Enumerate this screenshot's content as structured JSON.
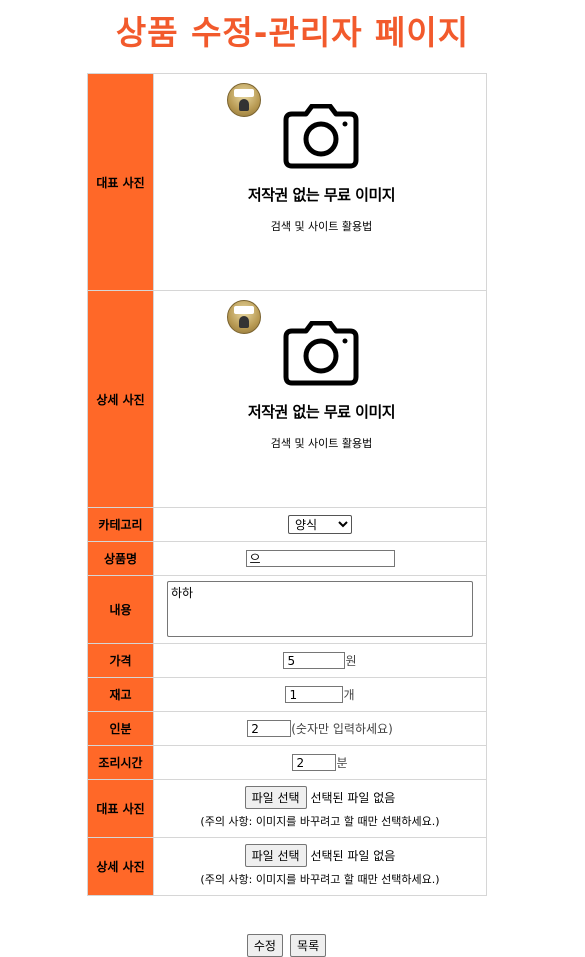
{
  "page": {
    "title": "상품 수정-관리자 페이지"
  },
  "image_placeholder": {
    "title": "저작권 없는 무료 이미지",
    "subtitle": "검색 및 사이트 활용법"
  },
  "rows": {
    "main_photo": {
      "label": "대표 사진"
    },
    "detail_photo": {
      "label": "상세 사진"
    },
    "category": {
      "label": "카테고리",
      "selected": "양식"
    },
    "name": {
      "label": "상품명",
      "value": "으"
    },
    "content": {
      "label": "내용",
      "value": "하하"
    },
    "price": {
      "label": "가격",
      "value": "5",
      "unit": "원"
    },
    "stock": {
      "label": "재고",
      "value": "1",
      "unit": "개"
    },
    "servings": {
      "label": "인분",
      "value": "2",
      "hint": "(숫자만 입력하세요)"
    },
    "cook_time": {
      "label": "조리시간",
      "value": "2",
      "unit": "분"
    },
    "main_file": {
      "label": "대표 사진",
      "button": "파일 선택",
      "status": "선택된 파일 없음",
      "note": "(주의 사항: 이미지를 바꾸려고 할 때만 선택하세요.)"
    },
    "detail_file": {
      "label": "상세 사진",
      "button": "파일 선택",
      "status": "선택된 파일 없음",
      "note": "(주의 사항: 이미지를 바꾸려고 할 때만 선택하세요.)"
    }
  },
  "actions": {
    "edit": "수정",
    "list": "목록"
  },
  "colors": {
    "title": "#f25a2c",
    "label_bg": "#ff6828"
  }
}
